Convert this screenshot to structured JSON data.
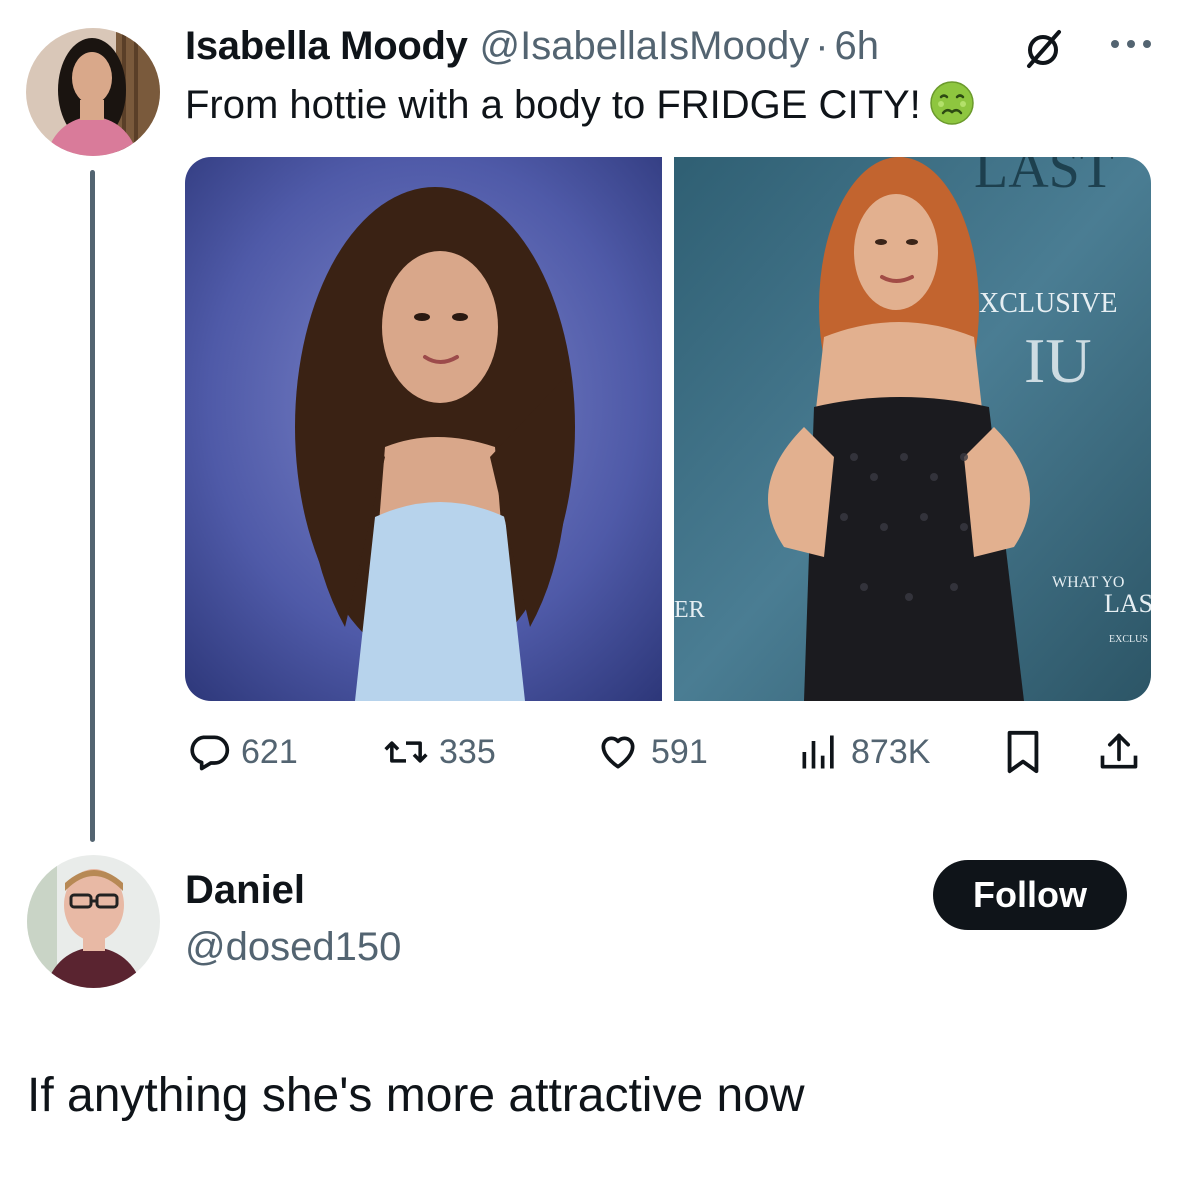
{
  "original_tweet": {
    "author_name": "Isabella Moody",
    "author_handle": "@IsabellaIsMoody",
    "separator": "·",
    "time": "6h",
    "text": "From hottie with a body to FRIDGE CITY!",
    "emoji": "nauseated-face-emoji",
    "media": [
      {
        "description_icon": "photo-young-woman-blue-top"
      },
      {
        "description_icon": "photo-woman-black-dress-red-carpet",
        "visible_text": [
          "XCLUSIVE",
          "ER",
          "WHAT YO",
          "LAS",
          "EXCLUS"
        ]
      }
    ],
    "stats": {
      "replies": "621",
      "retweets": "335",
      "likes": "591",
      "views": "873K"
    }
  },
  "reply": {
    "author_name": "Daniel",
    "author_handle": "@dosed150",
    "follow_label": "Follow",
    "text": "If anything she's more attractive now"
  },
  "colors": {
    "text_primary": "#0f1419",
    "text_secondary": "#536471",
    "thread_line": "#536471",
    "follow_bg": "#0f1419"
  }
}
